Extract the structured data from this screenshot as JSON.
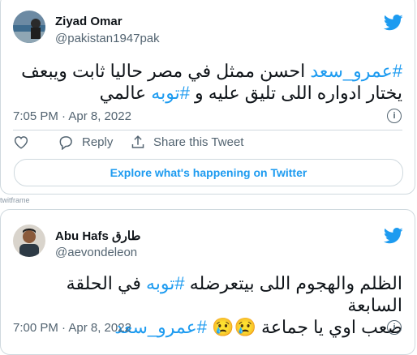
{
  "tweet1": {
    "name": "Ziyad Omar",
    "handle": "@pakistan1947pak",
    "hashtag1": "#عمرو_سعد",
    "line1_rest": " احسن ممثل في مصر حاليا ثابت ويبعف",
    "line2_pre": "يختار ادواره اللى تليق عليه و ",
    "hashtag2": "#توبه",
    "line2_post": " عالمي",
    "time": "7:05 PM · Apr 8, 2022",
    "reply_label": "Reply",
    "share_label": "Share this Tweet",
    "explore_label": "Explore what's happening on Twitter"
  },
  "frame_label": "twitframe",
  "tweet2": {
    "name": "Abu Hafs طارق",
    "handle": "@aevondeleon",
    "line1_pre": "الظلم والهجوم اللى بيتعرضله ",
    "hashtag1": "#توبه",
    "line1_post": " في الحلقة السابعة",
    "line2_pre": "صعب اوي يا جماعة ",
    "emoji": "😢😢",
    "hashtag2": "#عمرو_سعد",
    "time": "7:00 PM · Apr 8, 2022"
  },
  "colors": {
    "accent": "#1d9bf0",
    "muted": "#536471",
    "border": "#cfd9de"
  },
  "icons": [
    "twitter-bird-icon",
    "info-icon",
    "heart-icon",
    "reply-icon",
    "share-icon"
  ]
}
